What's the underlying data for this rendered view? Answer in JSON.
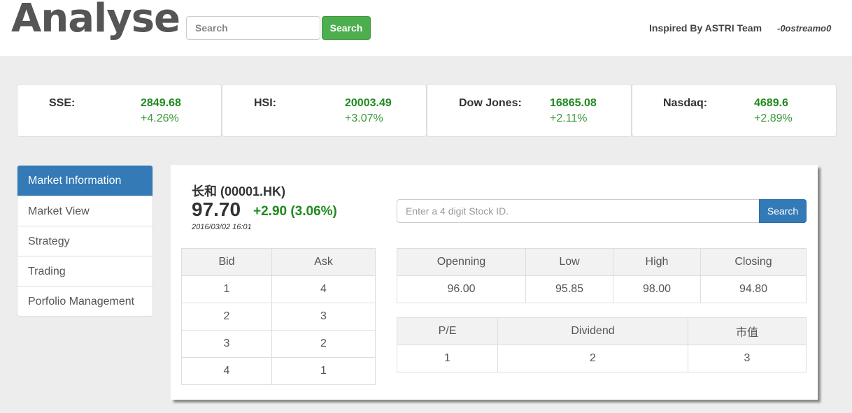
{
  "header": {
    "brand": "Analyse",
    "search_placeholder": "Search",
    "search_button": "Search",
    "inspired": "Inspired By ASTRI Team",
    "author": "-0ostreamo0"
  },
  "indices": [
    {
      "name": "SSE:",
      "value": "2849.68",
      "change": "+4.26%"
    },
    {
      "name": "HSI:",
      "value": "20003.49",
      "change": "+3.07%"
    },
    {
      "name": "Dow Jones:",
      "value": "16865.08",
      "change": "+2.11%"
    },
    {
      "name": "Nasdaq:",
      "value": "4689.6",
      "change": "+2.89%"
    }
  ],
  "sidebar": {
    "items": [
      {
        "label": "Market Information"
      },
      {
        "label": "Market View"
      },
      {
        "label": "Strategy"
      },
      {
        "label": "Trading"
      },
      {
        "label": "Porfolio Management"
      }
    ]
  },
  "stock": {
    "name": "长和 (00001.HK)",
    "price": "97.70",
    "change": "+2.90 (3.06%)",
    "time": "2016/03/02 16:01",
    "input_placeholder": "Enter a 4 digit Stock ID.",
    "search_button": "Search"
  },
  "bidask": {
    "headers": [
      "Bid",
      "Ask"
    ],
    "rows": [
      [
        "1",
        "4"
      ],
      [
        "2",
        "3"
      ],
      [
        "3",
        "2"
      ],
      [
        "4",
        "1"
      ]
    ]
  },
  "ohlc": {
    "headers": [
      "Openning",
      "Low",
      "High",
      "Closing"
    ],
    "values": [
      "96.00",
      "95.85",
      "98.00",
      "94.80"
    ]
  },
  "fundamentals": {
    "headers": [
      "P/E",
      "Dividend",
      "市值"
    ],
    "values": [
      "1",
      "2",
      "3"
    ]
  },
  "colors": {
    "accent_blue": "#337ab7",
    "green_button": "#4cae4c",
    "positive": "#1f8a1f"
  }
}
